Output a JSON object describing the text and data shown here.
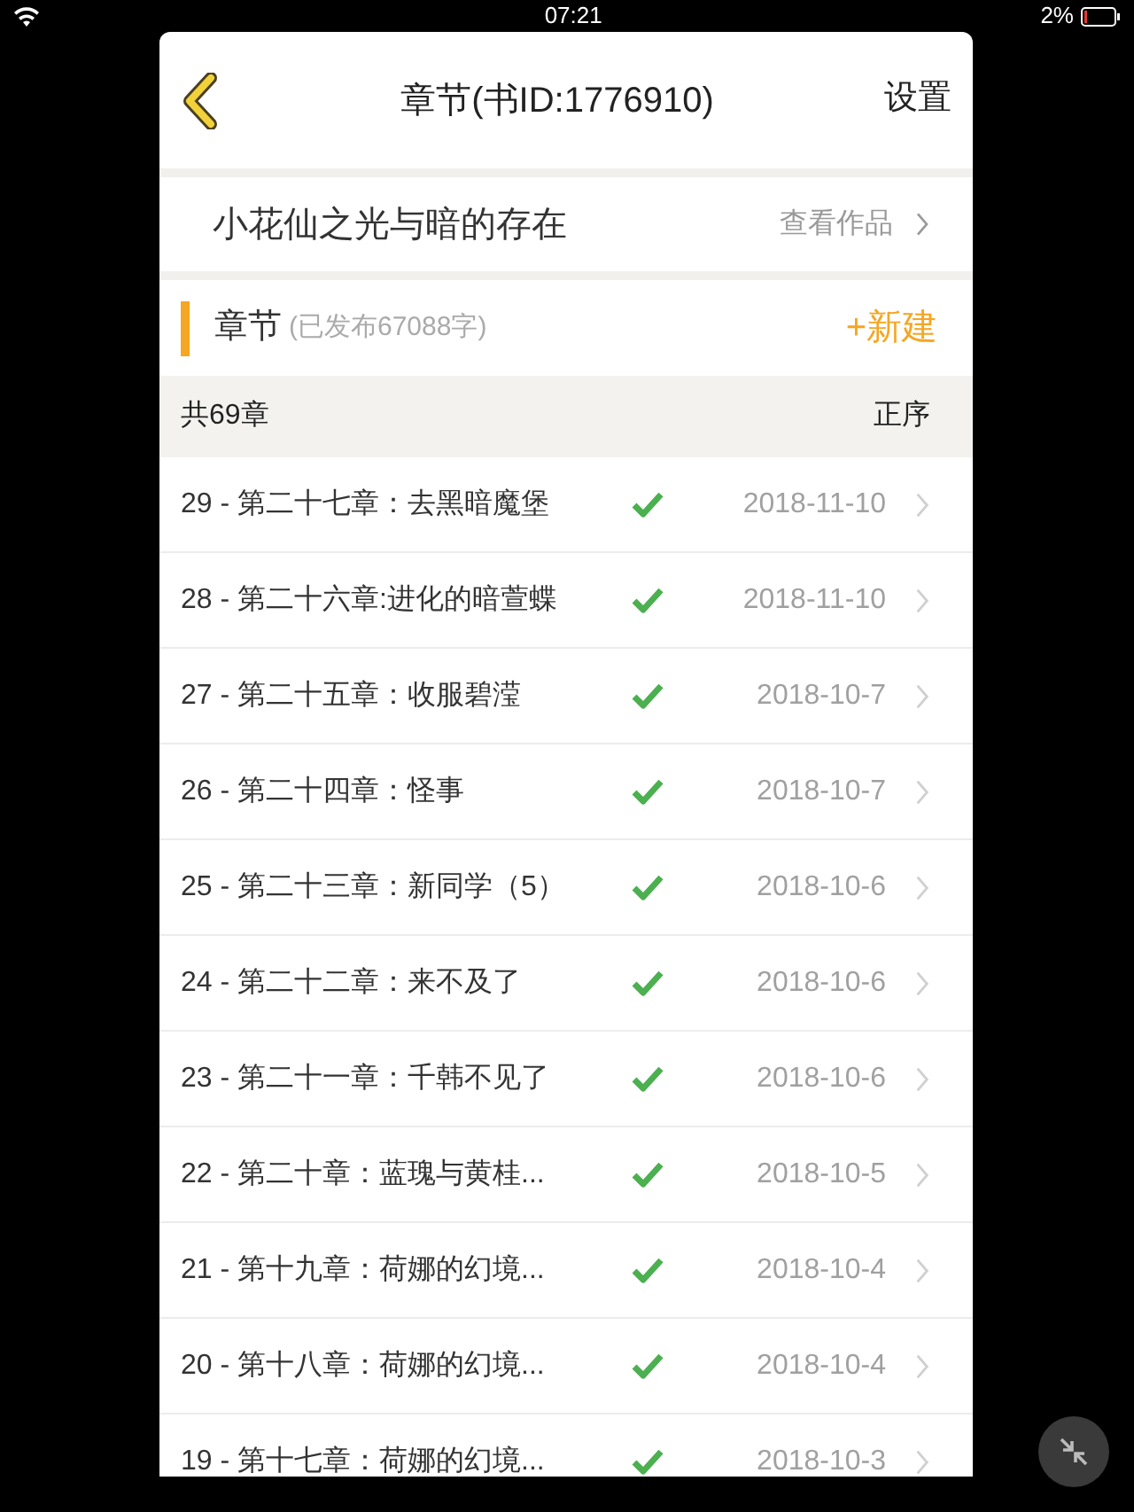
{
  "status_bar": {
    "time": "07:21",
    "battery": "2%"
  },
  "header": {
    "title": "章节(书ID:1776910)",
    "action": "设置"
  },
  "book": {
    "title": "小花仙之光与暗的存在",
    "link": "查看作品"
  },
  "section": {
    "title": "章节",
    "subtitle": "(已发布67088字)",
    "new_button": "+新建"
  },
  "list_header": {
    "count": "共69章",
    "sort": "正序"
  },
  "chapters": [
    {
      "title": "29 - 第二十七章：去黑暗魔堡",
      "published": true,
      "date": "2018-11-10"
    },
    {
      "title": "28 - 第二十六章:进化的暗萱蝶",
      "published": true,
      "date": "2018-11-10"
    },
    {
      "title": "27 - 第二十五章：收服碧滢",
      "published": true,
      "date": "2018-10-7"
    },
    {
      "title": "26 - 第二十四章：怪事",
      "published": true,
      "date": "2018-10-7"
    },
    {
      "title": "25 - 第二十三章：新同学（5）",
      "published": true,
      "date": "2018-10-6"
    },
    {
      "title": "24 - 第二十二章：来不及了",
      "published": true,
      "date": "2018-10-6"
    },
    {
      "title": "23 - 第二十一章：千韩不见了",
      "published": true,
      "date": "2018-10-6"
    },
    {
      "title": "22 - 第二十章：蓝瑰与黄桂...",
      "published": true,
      "date": "2018-10-5"
    },
    {
      "title": "21 - 第十九章：荷娜的幻境...",
      "published": true,
      "date": "2018-10-4"
    },
    {
      "title": "20 - 第十八章：荷娜的幻境...",
      "published": true,
      "date": "2018-10-4"
    },
    {
      "title": "19 - 第十七章：荷娜的幻境...",
      "published": true,
      "date": "2018-10-3"
    }
  ]
}
